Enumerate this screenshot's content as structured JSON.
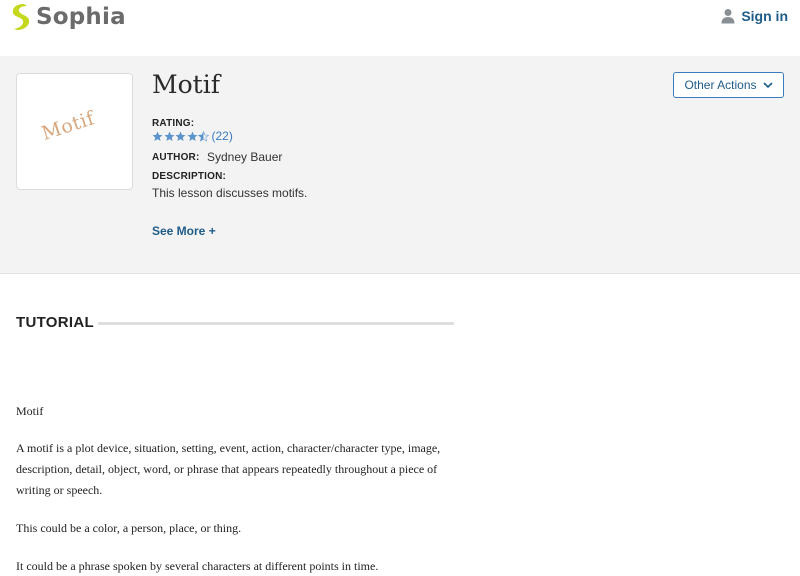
{
  "header": {
    "brand": "Sophia",
    "logo_icon": "sophia-logo-icon",
    "signin_label": "Sign in",
    "signin_icon": "user-icon"
  },
  "lesson": {
    "thumbnail_text": "Motif",
    "title": "Motif",
    "rating_label": "RATING:",
    "rating_value": 4.5,
    "rating_max": 5,
    "rating_count": "(22)",
    "author_label": "AUTHOR:",
    "author": "Sydney Bauer",
    "description_label": "DESCRIPTION:",
    "description": "This lesson discusses motifs.",
    "see_more": "See More +",
    "other_actions": "Other Actions"
  },
  "tutorial": {
    "heading": "TUTORIAL",
    "paragraphs": [
      "Motif",
      "A motif is a plot device, situation, setting, event, action, character/character type, image, description, detail, object, word, or phrase that appears repeatedly throughout a piece of writing or speech.",
      "This could be a color, a person, place, or thing.",
      "It could be a phrase spoken by several characters at different points in time."
    ]
  },
  "colors": {
    "brand_green": "#c5d81e",
    "link_blue": "#1f5c88",
    "star_blue": "#5b93cc",
    "hero_bg": "#f3f3f3"
  }
}
